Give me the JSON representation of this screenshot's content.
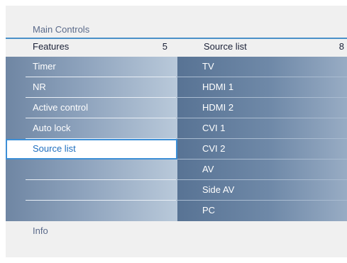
{
  "breadcrumb": "Main Controls",
  "left_header": {
    "title": "Features",
    "count": "5"
  },
  "right_header": {
    "title": "Source list",
    "count": "8"
  },
  "left_items": [
    {
      "label": "Timer"
    },
    {
      "label": "NR"
    },
    {
      "label": "Active control"
    },
    {
      "label": "Auto lock"
    },
    {
      "label": "Source list",
      "selected": true
    },
    {
      "label": ""
    },
    {
      "label": ""
    },
    {
      "label": ""
    }
  ],
  "right_items": [
    {
      "label": "TV"
    },
    {
      "label": "HDMI 1"
    },
    {
      "label": "HDMI 2"
    },
    {
      "label": "CVI 1"
    },
    {
      "label": "CVI 2"
    },
    {
      "label": "AV"
    },
    {
      "label": "Side AV"
    },
    {
      "label": "PC"
    }
  ],
  "info": "Info",
  "colors": {
    "accent": "#3d8fd6",
    "header_line": "#4a90c8"
  }
}
